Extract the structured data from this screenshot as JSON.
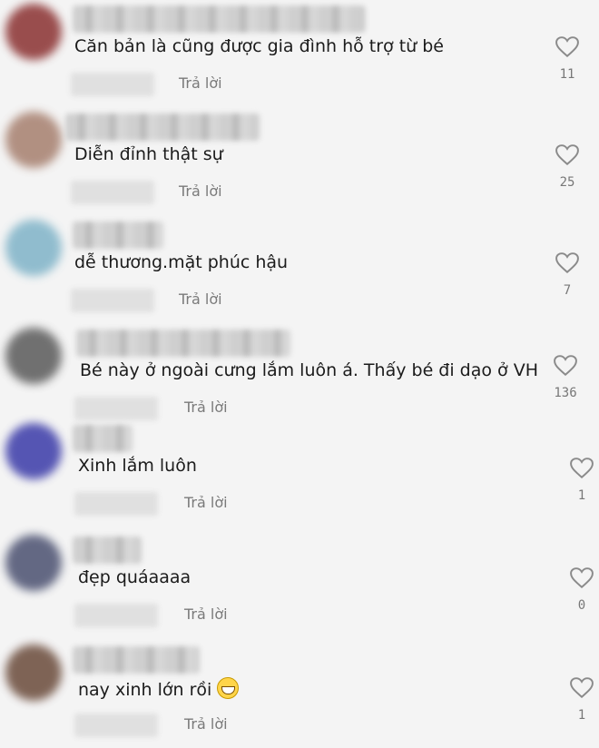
{
  "reply_label": "Trả lời",
  "comments": [
    {
      "text": "Căn bản là cũng được gia đình hỗ trợ từ bé",
      "likes": "11",
      "avatar_color": "#8a3030"
    },
    {
      "text": "Diễn đỉnh thật sự",
      "likes": "25",
      "avatar_color": "#a67f6e"
    },
    {
      "text": "dễ thương.mặt phúc hậu",
      "likes": "7",
      "avatar_color": "#7fb3c8"
    },
    {
      "text": "Bé này ở ngoài cưng lắm luôn á. Thấy bé đi dạo ở VH",
      "likes": "136",
      "avatar_color": "#5a5a5a"
    },
    {
      "text": "Xinh lắm luôn",
      "likes": "1",
      "avatar_color": "#3a3aa8"
    },
    {
      "text": "đẹp quáaaaa",
      "likes": "0",
      "avatar_color": "#4a5070"
    },
    {
      "text": "nay xinh lớn rồi",
      "likes": "1",
      "avatar_color": "#6a4a3a",
      "emoji": "grinning-face-emoji"
    }
  ]
}
